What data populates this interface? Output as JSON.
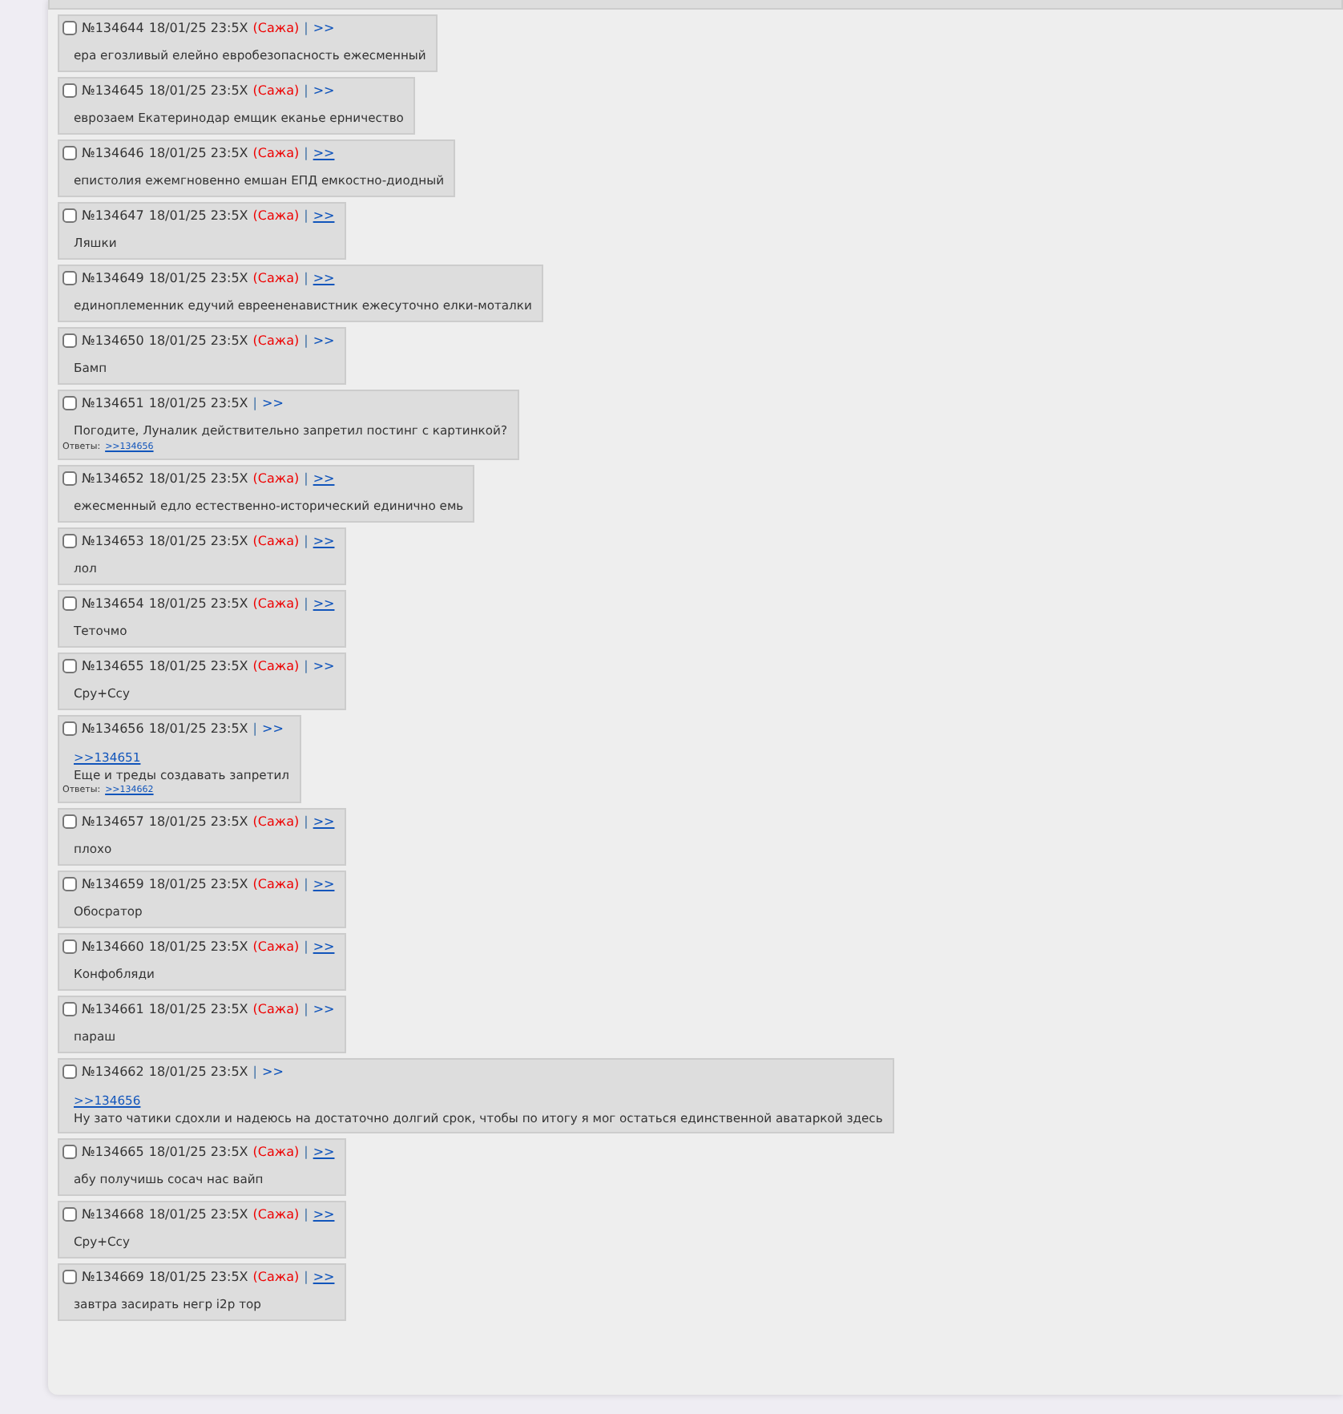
{
  "posts": [
    {
      "checked": false,
      "number": "№134644",
      "date": "18/01/25 23:5X",
      "sage": "(Сажа)",
      "separator": "|",
      "link": ">>",
      "underlined": false,
      "text": "ера егозливый елейно евробезопасность ежесменный"
    },
    {
      "checked": false,
      "number": "№134645",
      "date": "18/01/25 23:5X",
      "sage": "(Сажа)",
      "separator": "|",
      "link": ">>",
      "underlined": false,
      "text": "еврозаем Екатеринодар емщик еканье ерничество"
    },
    {
      "checked": false,
      "number": "№134646",
      "date": "18/01/25 23:5X",
      "sage": "(Сажа)",
      "separator": "|",
      "link": ">>",
      "underlined": true,
      "text": "епистолия ежемгновенно емшан ЕПД емкостно-диодный"
    },
    {
      "checked": false,
      "number": "№134647",
      "date": "18/01/25 23:5X",
      "sage": "(Сажа)",
      "separator": "|",
      "link": ">>",
      "underlined": true,
      "text": "Ляшки"
    },
    {
      "checked": false,
      "number": "№134649",
      "date": "18/01/25 23:5X",
      "sage": "(Сажа)",
      "separator": "|",
      "link": ">>",
      "underlined": true,
      "text": "единоплеменник едучий евреененавистник ежесуточно елки-моталки"
    },
    {
      "checked": false,
      "number": "№134650",
      "date": "18/01/25 23:5X",
      "sage": "(Сажа)",
      "separator": "|",
      "link": ">>",
      "underlined": false,
      "text": "Бамп"
    },
    {
      "checked": false,
      "number": "№134651",
      "date": "18/01/25 23:5X",
      "separator": "|",
      "link": ">>",
      "underlined": false,
      "text": "Погодите, Луналик действительно запретил постинг с картинкой?",
      "replies_label": "Ответы:",
      "replies": [
        ">>134656"
      ]
    },
    {
      "checked": false,
      "number": "№134652",
      "date": "18/01/25 23:5X",
      "sage": "(Сажа)",
      "separator": "|",
      "link": ">>",
      "underlined": true,
      "text": "ежесменный едло естественно-исторический единично емь"
    },
    {
      "checked": false,
      "number": "№134653",
      "date": "18/01/25 23:5X",
      "sage": "(Сажа)",
      "separator": "|",
      "link": ">>",
      "underlined": true,
      "text": "лол"
    },
    {
      "checked": false,
      "number": "№134654",
      "date": "18/01/25 23:5X",
      "sage": "(Сажа)",
      "separator": "|",
      "link": ">>",
      "underlined": true,
      "text": "Теточмо"
    },
    {
      "checked": false,
      "number": "№134655",
      "date": "18/01/25 23:5X",
      "sage": "(Сажа)",
      "separator": "|",
      "link": ">>",
      "underlined": false,
      "text": "Cpy+Ccy"
    },
    {
      "checked": false,
      "number": "№134656",
      "date": "18/01/25 23:5X",
      "separator": "|",
      "link": ">>",
      "underlined": false,
      "quote": ">>134651",
      "text": "Еще и треды создавать запретил",
      "replies_label": "Ответы:",
      "replies": [
        ">>134662"
      ]
    },
    {
      "checked": false,
      "number": "№134657",
      "date": "18/01/25 23:5X",
      "sage": "(Сажа)",
      "separator": "|",
      "link": ">>",
      "underlined": true,
      "text": "плохо"
    },
    {
      "checked": false,
      "number": "№134659",
      "date": "18/01/25 23:5X",
      "sage": "(Сажа)",
      "separator": "|",
      "link": ">>",
      "underlined": true,
      "text": "Обосратор"
    },
    {
      "checked": false,
      "number": "№134660",
      "date": "18/01/25 23:5X",
      "sage": "(Сажа)",
      "separator": "|",
      "link": ">>",
      "underlined": true,
      "text": "Конфобляди"
    },
    {
      "checked": false,
      "number": "№134661",
      "date": "18/01/25 23:5X",
      "sage": "(Сажа)",
      "separator": "|",
      "link": ">>",
      "underlined": false,
      "text": "параш"
    },
    {
      "checked": false,
      "number": "№134662",
      "date": "18/01/25 23:5X",
      "separator": "|",
      "link": ">>",
      "underlined": false,
      "quote": ">>134656",
      "text": "Ну зато чатики сдохли и надеюсь на достаточно долгий срок, чтобы по итогу я мог остаться единственной аватаркой здесь"
    },
    {
      "checked": false,
      "number": "№134665",
      "date": "18/01/25 23:5X",
      "sage": "(Сажа)",
      "separator": "|",
      "link": ">>",
      "underlined": true,
      "text": "абу получишь сосач нас вайп"
    },
    {
      "checked": false,
      "number": "№134668",
      "date": "18/01/25 23:5X",
      "sage": "(Сажа)",
      "separator": "|",
      "link": ">>",
      "underlined": true,
      "text": "Cpy+Ccy"
    },
    {
      "checked": false,
      "number": "№134669",
      "date": "18/01/25 23:5X",
      "sage": "(Сажа)",
      "separator": "|",
      "link": ">>",
      "underlined": true,
      "text": "завтра засирать негр i2p тор"
    }
  ]
}
